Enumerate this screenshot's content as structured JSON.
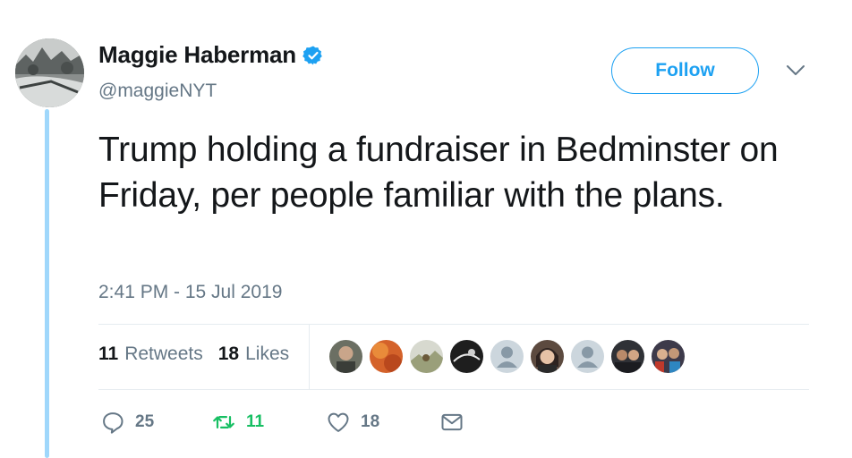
{
  "user": {
    "name": "Maggie Haberman",
    "handle": "@maggieNYT",
    "follow_label": "Follow"
  },
  "tweet": {
    "text": "Trump holding a fundraiser in Bedminster on Friday, per people familiar with the plans.",
    "timestamp": "2:41 PM - 15 Jul 2019"
  },
  "stats": {
    "retweets_count": "11",
    "retweets_label": "Retweets",
    "likes_count": "18",
    "likes_label": "Likes"
  },
  "likers": [
    "photo",
    "orange",
    "outdoor",
    "dark",
    "default",
    "woman",
    "default",
    "group",
    "group-colorful"
  ],
  "actions": {
    "reply_count": "25",
    "retweet_count": "11",
    "like_count": "18"
  },
  "colors": {
    "accent": "#1da1f2",
    "retweet_green": "#17bf63",
    "secondary_text": "#657786",
    "thread_line": "#9fd7fb"
  },
  "icons": [
    "verified-badge-icon",
    "chevron-down-icon",
    "reply-icon",
    "retweet-icon",
    "like-heart-icon",
    "direct-message-icon"
  ]
}
